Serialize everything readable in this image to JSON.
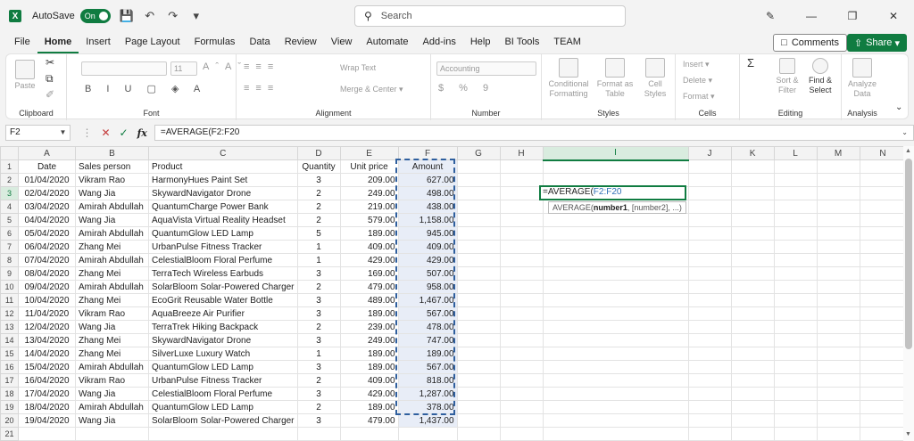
{
  "titlebar": {
    "autosave_label": "AutoSave",
    "autosave_state": "On",
    "search_placeholder": "Search"
  },
  "menu": [
    "File",
    "Home",
    "Insert",
    "Page Layout",
    "Formulas",
    "Data",
    "Review",
    "View",
    "Automate",
    "Add-ins",
    "Help",
    "BI Tools",
    "TEAM"
  ],
  "comments_label": "Comments",
  "share_label": "Share",
  "ribbon": {
    "clipboard": {
      "label": "Clipboard",
      "paste": "Paste"
    },
    "font": {
      "label": "Font",
      "size": "11"
    },
    "alignment": {
      "label": "Alignment",
      "wrap": "Wrap Text",
      "merge": "Merge & Center"
    },
    "number": {
      "label": "Number",
      "format": "Accounting"
    },
    "styles": {
      "label": "Styles",
      "cond": "Conditional Formatting",
      "table": "Format as Table",
      "cell": "Cell Styles"
    },
    "cells": {
      "label": "Cells",
      "insert": "Insert",
      "delete": "Delete",
      "format": "Format"
    },
    "editing": {
      "label": "Editing",
      "sort": "Sort & Filter",
      "find": "Find & Select"
    },
    "analysis": {
      "label": "Analysis",
      "analyze": "Analyze Data"
    }
  },
  "formula_bar": {
    "name_box": "F2",
    "formula": "=AVERAGE(F2:F20"
  },
  "columns": [
    "A",
    "B",
    "C",
    "D",
    "E",
    "F",
    "G",
    "H",
    "I",
    "J",
    "K",
    "L",
    "M",
    "N"
  ],
  "headers": [
    "Date",
    "Sales person",
    "Product",
    "Quantity",
    "Unit price",
    "Amount"
  ],
  "rows": [
    [
      "01/04/2020",
      "Vikram Rao",
      "HarmonyHues Paint Set",
      "3",
      "209.00",
      "627.00"
    ],
    [
      "02/04/2020",
      "Wang Jia",
      "SkywardNavigator Drone",
      "2",
      "249.00",
      "498.00"
    ],
    [
      "03/04/2020",
      "Amirah Abdullah",
      "QuantumCharge Power Bank",
      "2",
      "219.00",
      "438.00"
    ],
    [
      "04/04/2020",
      "Wang Jia",
      "AquaVista Virtual Reality Headset",
      "2",
      "579.00",
      "1,158.00"
    ],
    [
      "05/04/2020",
      "Amirah Abdullah",
      "QuantumGlow LED Lamp",
      "5",
      "189.00",
      "945.00"
    ],
    [
      "06/04/2020",
      "Zhang Mei",
      "UrbanPulse Fitness Tracker",
      "1",
      "409.00",
      "409.00"
    ],
    [
      "07/04/2020",
      "Amirah Abdullah",
      "CelestialBloom Floral Perfume",
      "1",
      "429.00",
      "429.00"
    ],
    [
      "08/04/2020",
      "Zhang Mei",
      "TerraTech Wireless Earbuds",
      "3",
      "169.00",
      "507.00"
    ],
    [
      "09/04/2020",
      "Amirah Abdullah",
      "SolarBloom Solar-Powered Charger",
      "2",
      "479.00",
      "958.00"
    ],
    [
      "10/04/2020",
      "Zhang Mei",
      "EcoGrit Reusable Water Bottle",
      "3",
      "489.00",
      "1,467.00"
    ],
    [
      "11/04/2020",
      "Vikram Rao",
      "AquaBreeze Air Purifier",
      "3",
      "189.00",
      "567.00"
    ],
    [
      "12/04/2020",
      "Wang Jia",
      "TerraTrek Hiking Backpack",
      "2",
      "239.00",
      "478.00"
    ],
    [
      "13/04/2020",
      "Zhang Mei",
      "SkywardNavigator Drone",
      "3",
      "249.00",
      "747.00"
    ],
    [
      "14/04/2020",
      "Zhang Mei",
      "SilverLuxe Luxury Watch",
      "1",
      "189.00",
      "189.00"
    ],
    [
      "15/04/2020",
      "Amirah Abdullah",
      "QuantumGlow LED Lamp",
      "3",
      "189.00",
      "567.00"
    ],
    [
      "16/04/2020",
      "Vikram Rao",
      "UrbanPulse Fitness Tracker",
      "2",
      "409.00",
      "818.00"
    ],
    [
      "17/04/2020",
      "Wang Jia",
      "CelestialBloom Floral Perfume",
      "3",
      "429.00",
      "1,287.00"
    ],
    [
      "18/04/2020",
      "Amirah Abdullah",
      "QuantumGlow LED Lamp",
      "2",
      "189.00",
      "378.00"
    ],
    [
      "19/04/2020",
      "Wang Jia",
      "SolarBloom Solar-Powered Charger",
      "3",
      "479.00",
      "1,437.00"
    ]
  ],
  "editing_cell": {
    "prefix": "=AVERAGE(",
    "ref": "F2:F20"
  },
  "tooltip": {
    "fn": "AVERAGE(",
    "arg1": "number1",
    "rest": ", [number2], ...)"
  }
}
